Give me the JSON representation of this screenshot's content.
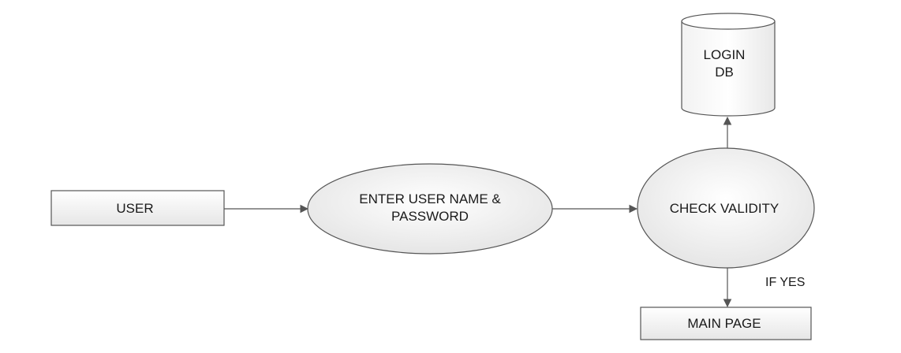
{
  "diagram": {
    "nodes": {
      "user": {
        "label": "USER"
      },
      "enter_credentials": {
        "label_lines": [
          "ENTER USER NAME &",
          "PASSWORD"
        ]
      },
      "check_validity": {
        "label": "CHECK VALIDITY"
      },
      "login_db": {
        "label_lines": [
          "LOGIN",
          "DB"
        ]
      },
      "main_page": {
        "label": "MAIN PAGE"
      }
    },
    "edges": {
      "validity_to_main_page": {
        "label": "IF YES"
      }
    }
  }
}
